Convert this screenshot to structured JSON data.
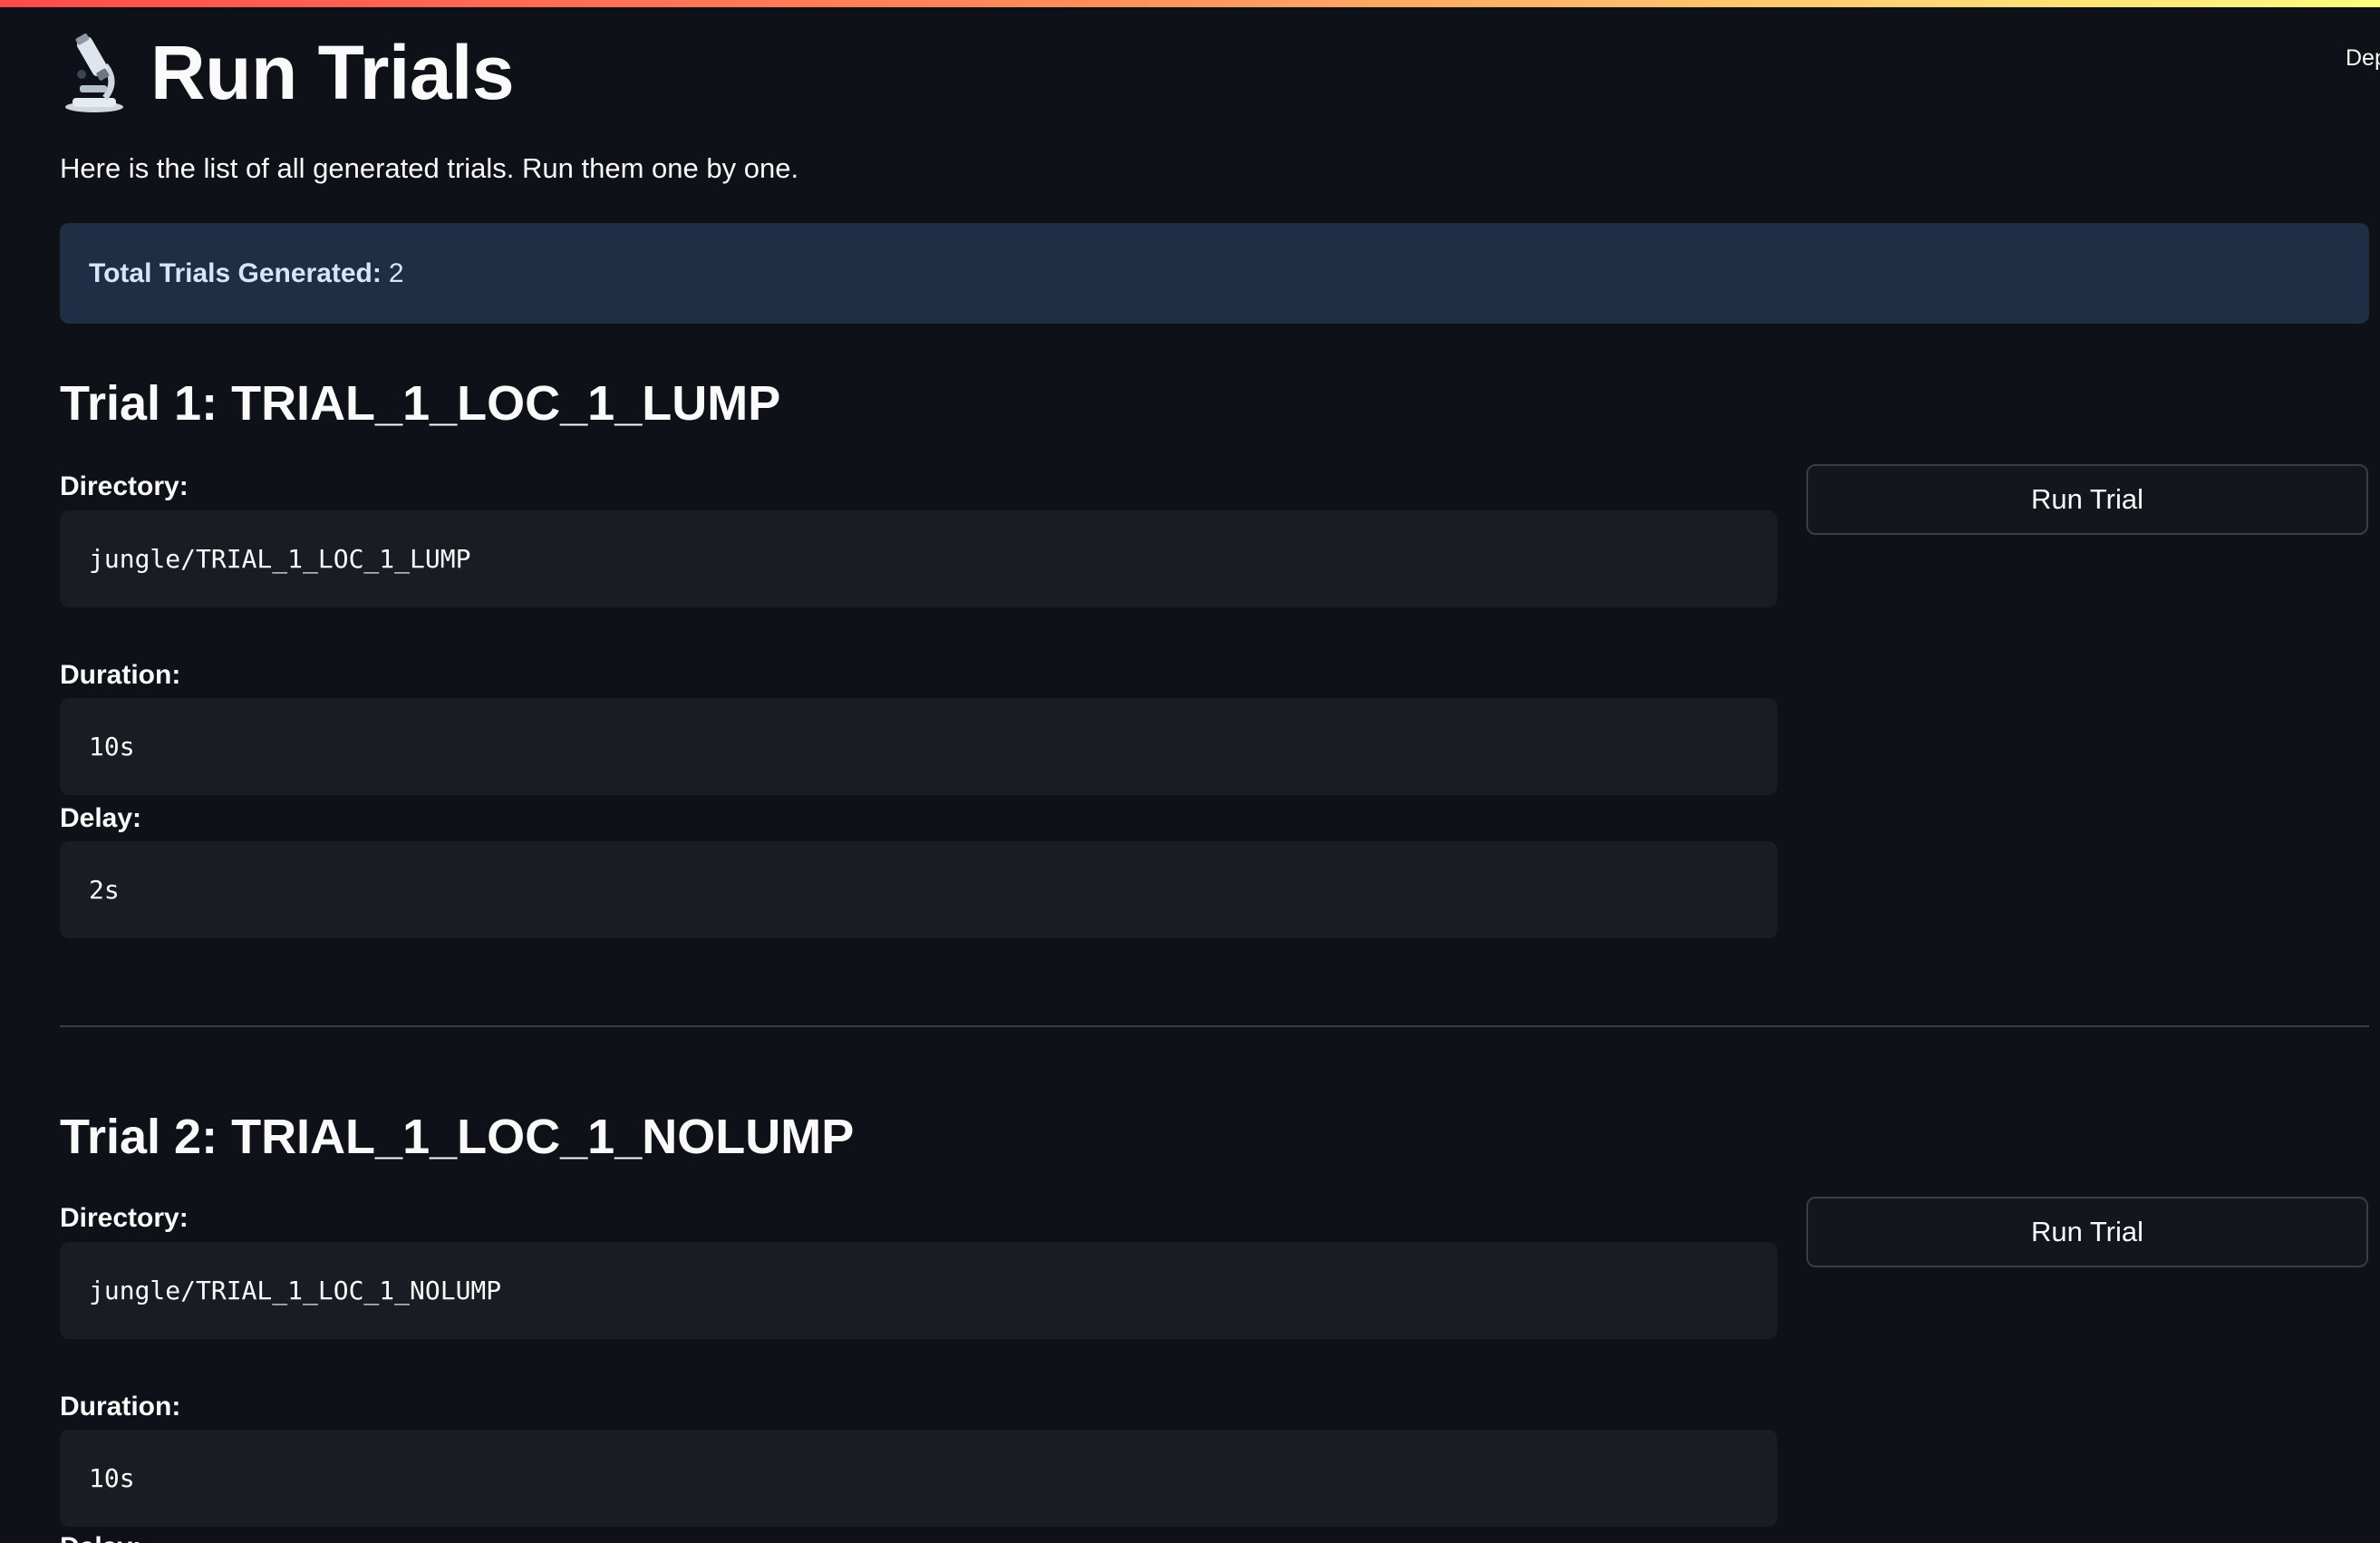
{
  "header": {
    "deploy_label": "Deploy",
    "icon": "microscope-icon",
    "title": "Run Trials",
    "subtitle": "Here is the list of all generated trials. Run them one by one."
  },
  "info": {
    "label": "Total Trials Generated:",
    "value": "2"
  },
  "trials": [
    {
      "title": "Trial 1: TRIAL_1_LOC_1_LUMP",
      "directory_label": "Directory:",
      "directory": "jungle/TRIAL_1_LOC_1_LUMP",
      "duration_label": "Duration:",
      "duration": "10s",
      "delay_label": "Delay:",
      "delay": "2s",
      "button_label": "Run Trial"
    },
    {
      "title": "Trial 2: TRIAL_1_LOC_1_NOLUMP",
      "directory_label": "Directory:",
      "directory": "jungle/TRIAL_1_LOC_1_NOLUMP",
      "duration_label": "Duration:",
      "duration": "10s",
      "delay_label": "Delay:",
      "button_label": "Run Trial"
    }
  ],
  "colors": {
    "background": "#0e1117",
    "info_background": "#1f2d45",
    "code_background": "#1a1c24",
    "accent_red": "#ff4b4b"
  }
}
